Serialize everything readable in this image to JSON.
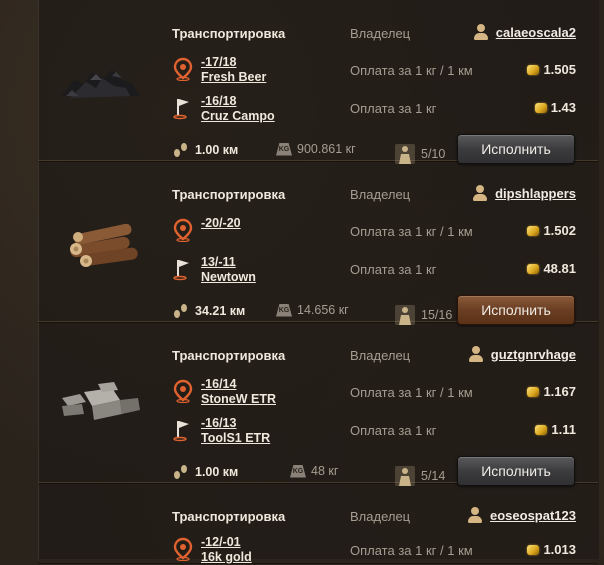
{
  "colors": {
    "background": "#2a231c",
    "text": "#efe8dd",
    "dim_text": "#a59d91",
    "gold": "#e6b33a",
    "button": "#3c3c3e",
    "button_active": "#6a3e22"
  },
  "labels": {
    "type": "Транспортировка",
    "owner": "Владелец",
    "pay_distance": "Оплата за 1 кг / 1 км",
    "pay_weight": "Оплата за 1 кг",
    "execute": "Исполнить"
  },
  "orders": [
    {
      "cargo_icon": "coal-pile-icon",
      "owner": "calaeoscala2",
      "from": {
        "coords": "-17/18",
        "city": "Fresh Beer"
      },
      "to": {
        "coords": "-16/18",
        "city": "Cruz Campo"
      },
      "pay_per_km": "1.505",
      "pay_per_kg": "1.43",
      "distance": "1.00 км",
      "weight": "900.861 кг",
      "crew": "5/10",
      "button_active": false
    },
    {
      "cargo_icon": "logs-icon",
      "owner": "dipshlappers",
      "from": {
        "coords": "-20/-20",
        "city": ""
      },
      "to": {
        "coords": "13/-11",
        "city": "Newtown"
      },
      "pay_per_km": "1.502",
      "pay_per_kg": "48.81",
      "distance": "34.21 км",
      "weight": "14.656 кг",
      "crew": "15/16",
      "button_active": true
    },
    {
      "cargo_icon": "stone-blocks-icon",
      "owner": "guztgnrvhage",
      "from": {
        "coords": "-16/14",
        "city": "StoneW ETR"
      },
      "to": {
        "coords": "-16/13",
        "city": "ToolS1 ETR"
      },
      "pay_per_km": "1.167",
      "pay_per_kg": "1.11",
      "distance": "1.00 км",
      "weight": "48 кг",
      "crew": "5/14",
      "button_active": false
    },
    {
      "cargo_icon": "",
      "owner": "eoseospat123",
      "from": {
        "coords": "-12/-01",
        "city": "16k gold"
      },
      "pay_per_km": "1.013"
    }
  ]
}
